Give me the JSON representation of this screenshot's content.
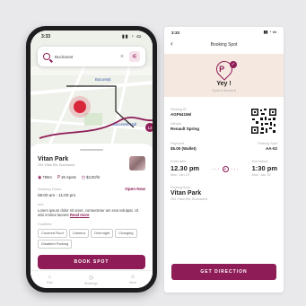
{
  "phone_left": {
    "status": {
      "time": "3:33",
      "icons": "signal wifi battery"
    },
    "search": {
      "value": "Bucharest",
      "clear": "×",
      "filter_icon": "filter-icon"
    },
    "map": {
      "label_1": "Bucureşti",
      "label_2": "Bucuresti Mall",
      "badge": "13"
    },
    "parking": {
      "name": "Vitan Park",
      "address": "254 Vitan Blv, Bucharest",
      "distance": "750m",
      "spots": "26 Spots",
      "price": "$3,00/hr",
      "hours_label": "Working Hours",
      "open_status": "Open Now",
      "hours": "08:00 am - 11:00 pm",
      "info_label": "Info",
      "info_text": "Lorem ipsum dolor sit amet, consectetur am erat volutpat. Ut wisi enimut laoreet",
      "read_more": "Read more",
      "facilities_label": "Facilities",
      "facilities": [
        "Covered Roof",
        "Camera",
        "Overnight",
        "Charging",
        "Disabled Parking"
      ],
      "book_button": "BOOK SPOT"
    },
    "tabs": [
      {
        "label": "Find",
        "icon": "home-icon"
      },
      {
        "label": "Bookings",
        "icon": "clock-icon"
      },
      {
        "label": "More",
        "icon": "user-icon"
      }
    ]
  },
  "booking": {
    "status": {
      "time": "3:33",
      "icons": "signal wifi battery"
    },
    "back": "‹",
    "title": "Booking Spot",
    "yey": "Yey !",
    "subtitle": "Spot is Booked",
    "parking_id_label": "Parking ID",
    "parking_id": "AGF64156/",
    "vehicle_label": "Vehicle",
    "vehicle": "Renault Spring",
    "payment_label": "Payment",
    "payment": "$5.00 (Wallet)",
    "spot_label": "Parking Spot",
    "spot": "AA-02",
    "enter_label": "Enter after",
    "enter_time": "12.30 pm",
    "enter_date": "Mon, Jan 19",
    "exit_label": "Exit before",
    "exit_time": "1:30 pm",
    "exit_date": "Mon, Jan 19",
    "park_label": "Parking Spot",
    "park_name": "Vitan Park",
    "park_address": "254 Vitan Blv, Bucharest",
    "direction_button": "GET DIRECTION"
  }
}
